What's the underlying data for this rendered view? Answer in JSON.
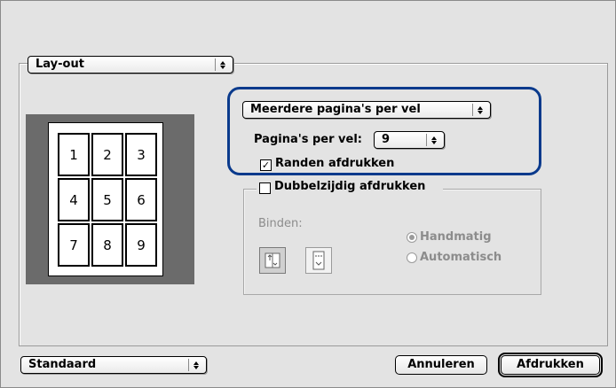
{
  "layout_popup": {
    "value": "Lay-out"
  },
  "preview": {
    "pages": [
      "1",
      "2",
      "3",
      "4",
      "5",
      "6",
      "7",
      "8",
      "9"
    ]
  },
  "multi_page": {
    "popup_value": "Meerdere pagina's per vel",
    "pages_per_sheet_label": "Pagina's per vel:",
    "pages_per_sheet_value": "9",
    "borders_label": "Randen afdrukken",
    "borders_checked": true
  },
  "duplex": {
    "label": "Dubbelzijdig afdrukken",
    "checked": false,
    "bind_label": "Binden:",
    "bind_options": [
      "book-binding-icon",
      "tablet-binding-icon"
    ],
    "radio_manual": "Handmatig",
    "radio_auto": "Automatisch",
    "selected": "Handmatig"
  },
  "footer": {
    "preset_value": "Standaard",
    "cancel_label": "Annuleren",
    "print_label": "Afdrukken"
  }
}
